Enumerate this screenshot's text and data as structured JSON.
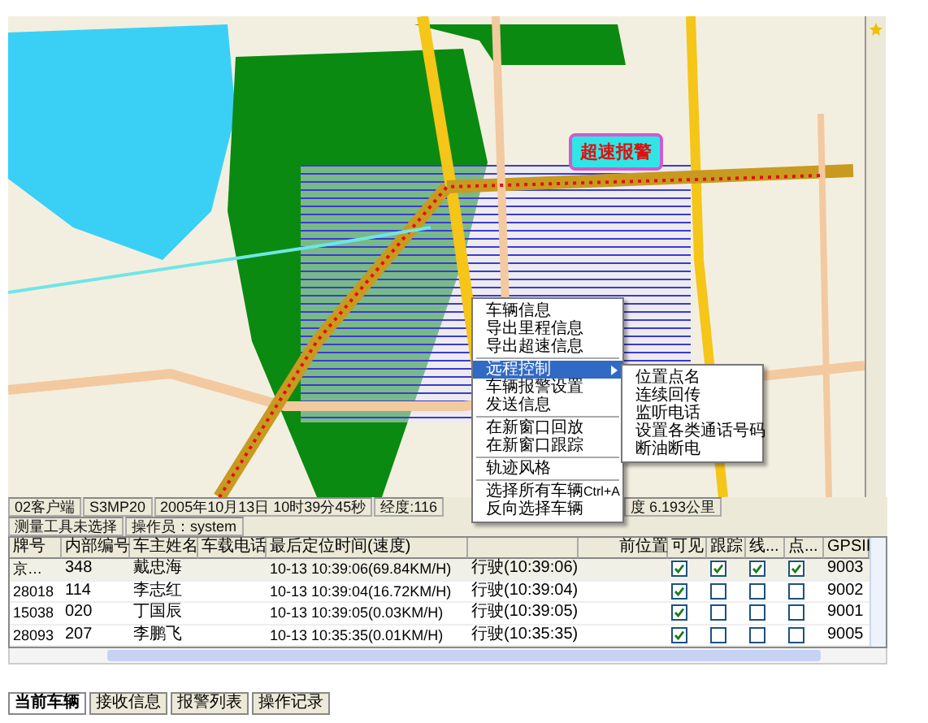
{
  "map": {
    "alarm_label": "超速报警"
  },
  "status_bar": {
    "top": [
      "02客户端",
      "S3MP20",
      "2005年10月13日 10时39分45秒",
      "经度:116"
    ],
    "top_right": [
      "度 6.193公里"
    ],
    "bottom": [
      "测量工具未选择",
      "操作员：system"
    ]
  },
  "table": {
    "columns": [
      {
        "label": "牌号"
      },
      {
        "label": "内部编号"
      },
      {
        "label": "车主姓名"
      },
      {
        "label": "车载电话"
      },
      {
        "label": "最后定位时间(速度)"
      },
      {},
      {
        "label": "前位置"
      },
      {
        "label": "可见"
      },
      {
        "label": "跟踪"
      },
      {
        "label": "线..."
      },
      {
        "label": "点..."
      },
      {
        "label": "GPSII"
      }
    ],
    "rows": [
      {
        "selected": true,
        "cells": [
          "京…",
          "348",
          "戴忠海",
          "",
          "10-13 10:39:06(69.84KM/H)",
          "行驶(10:39:06)",
          ""
        ],
        "checks": [
          true,
          true,
          true,
          true
        ],
        "gps": "9003"
      },
      {
        "selected": false,
        "cells": [
          "28018",
          "114",
          "李志红",
          "",
          "10-13 10:39:04(16.72KM/H)",
          "行驶(10:39:04)",
          ""
        ],
        "checks": [
          true,
          false,
          false,
          false
        ],
        "gps": "9002"
      },
      {
        "selected": false,
        "cells": [
          "15038",
          "020",
          "丁国辰",
          "",
          "10-13 10:39:05(0.03KM/H)",
          "行驶(10:39:05)",
          ""
        ],
        "checks": [
          true,
          false,
          false,
          false
        ],
        "gps": "9001"
      },
      {
        "selected": false,
        "cells": [
          "28093",
          "207",
          "李鹏飞",
          "",
          "10-13 10:35:35(0.01KM/H)",
          "行驶(10:35:35)",
          ""
        ],
        "checks": [
          true,
          false,
          false,
          false
        ],
        "gps": "9005"
      }
    ]
  },
  "tabs": [
    {
      "label": "当前车辆",
      "selected": true
    },
    {
      "label": "接收信息",
      "selected": false
    },
    {
      "label": "报警列表",
      "selected": false
    },
    {
      "label": "操作记录",
      "selected": false
    }
  ],
  "context_menu": {
    "items": [
      {
        "kind": "item",
        "label": "车辆信息",
        "selected": false
      },
      {
        "kind": "item",
        "label": "导出里程信息",
        "selected": false
      },
      {
        "kind": "item",
        "label": "导出超速信息",
        "selected": false
      },
      {
        "kind": "separator"
      },
      {
        "kind": "item",
        "label": "远程控制",
        "selected": true,
        "submenu": true
      },
      {
        "kind": "item",
        "label": "车辆报警设置",
        "selected": false
      },
      {
        "kind": "item",
        "label": "发送信息",
        "selected": false
      },
      {
        "kind": "separator"
      },
      {
        "kind": "item",
        "label": "在新窗口回放",
        "selected": false
      },
      {
        "kind": "item",
        "label": "在新窗口跟踪",
        "selected": false
      },
      {
        "kind": "separator"
      },
      {
        "kind": "item",
        "label": "轨迹风格",
        "selected": false
      },
      {
        "kind": "separator"
      },
      {
        "kind": "item",
        "label": "选择所有车辆",
        "shortcut": "Ctrl+A",
        "selected": false
      },
      {
        "kind": "item",
        "label": "反向选择车辆",
        "selected": false
      }
    ]
  },
  "submenu": {
    "items": [
      "位置点名",
      "连续回传",
      "监听电话",
      "设置各类通话号码",
      "断油断电"
    ]
  }
}
